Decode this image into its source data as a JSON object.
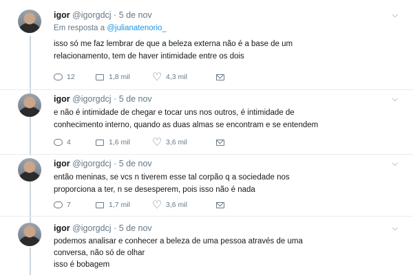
{
  "tweets": [
    {
      "name": "igor",
      "handle": "@igorgdcj",
      "separator": "·",
      "date": "5 de nov",
      "reply_prefix": "Em resposta a",
      "reply_to": "@julianatenorio_",
      "lines": [
        "isso só me faz lembrar de que a beleza externa não é a base de um",
        "relacionamento, tem de haver intimidade entre os dois"
      ],
      "replies": "12",
      "retweets": "1,8 mil",
      "likes": "4,3 mil"
    },
    {
      "name": "igor",
      "handle": "@igorgdcj",
      "separator": "·",
      "date": "5 de nov",
      "lines": [
        "e não é intimidade de chegar e tocar uns nos outros, é intimidade de",
        "conhecimento interno, quando as duas almas se encontram e se entendem"
      ],
      "replies": "4",
      "retweets": "1,6 mil",
      "likes": "3,6 mil"
    },
    {
      "name": "igor",
      "handle": "@igorgdcj",
      "separator": "·",
      "date": "5 de nov",
      "lines": [
        "então meninas, se vcs n tiverem esse tal corpão q a sociedade nos",
        "proporciona a ter, n se desesperem, pois isso não é nada"
      ],
      "replies": "7",
      "retweets": "1,7 mil",
      "likes": "3,6 mil"
    },
    {
      "name": "igor",
      "handle": "@igorgdcj",
      "separator": "·",
      "date": "5 de nov",
      "lines": [
        "podemos analisar e conhecer a beleza de uma pessoa através de uma",
        "conversa, não só de olhar",
        "isso é bobagem"
      ]
    }
  ],
  "icons": {
    "reply": "reply-icon",
    "retweet": "retweet-icon",
    "like": "heart-icon",
    "dm": "envelope-icon",
    "menu": "chevron-down-icon"
  },
  "colors": {
    "link": "#1b95e0",
    "secondary_text": "#657786",
    "thread_line": "#ccd6dd"
  }
}
